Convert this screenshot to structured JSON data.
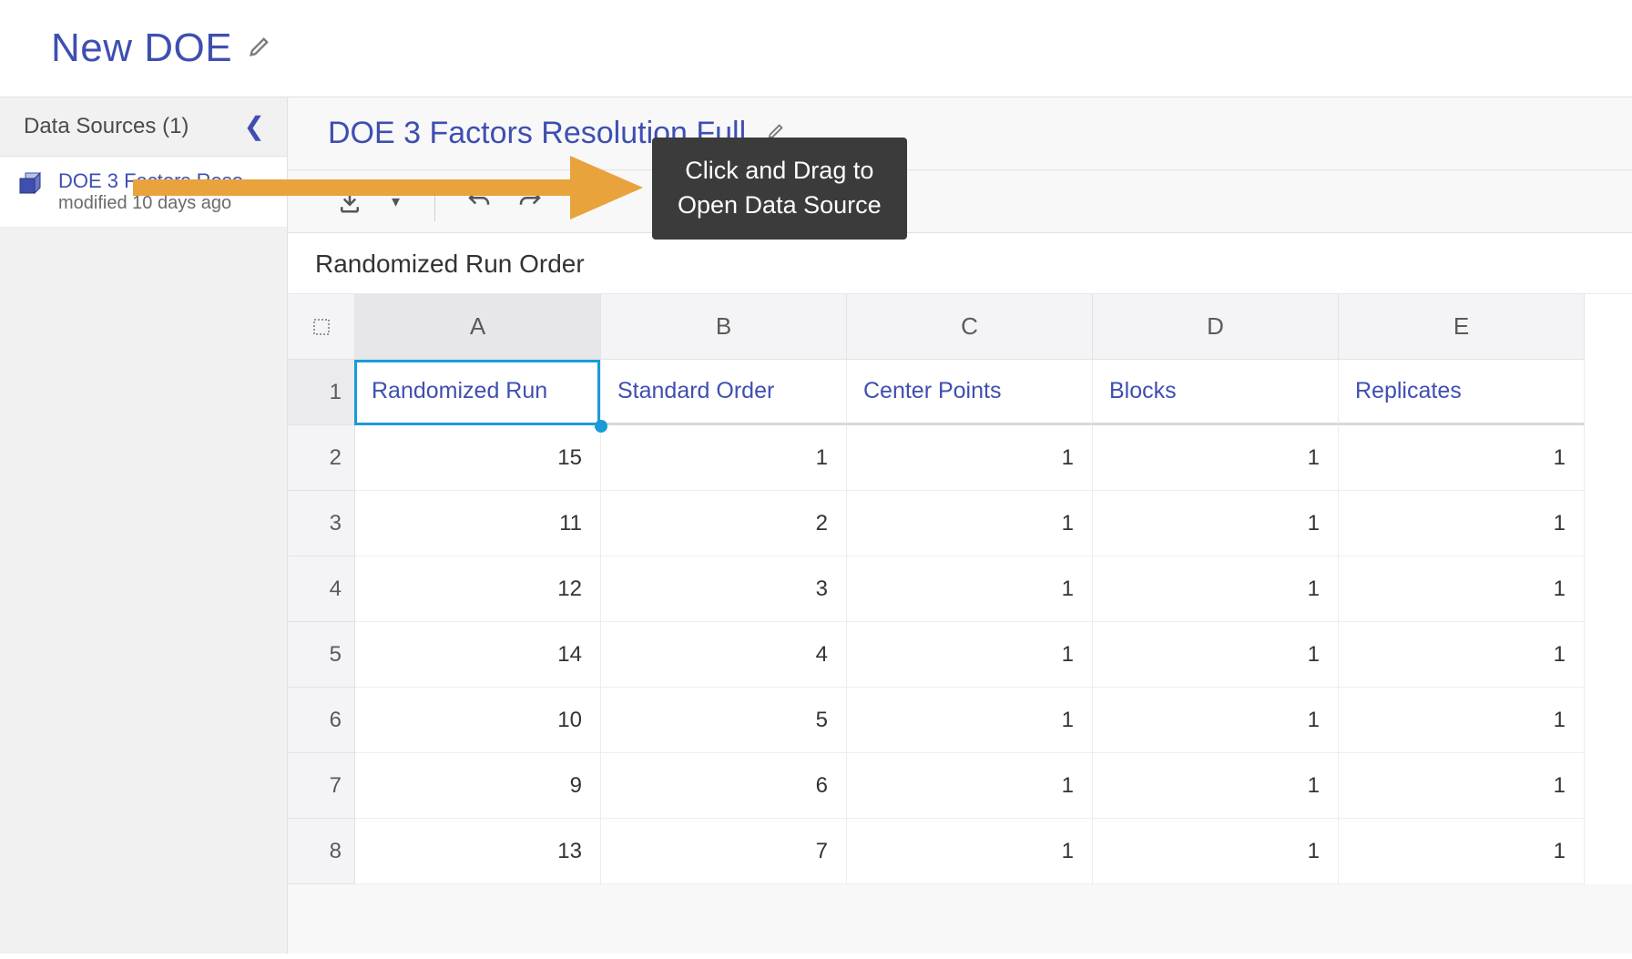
{
  "page": {
    "title": "New DOE"
  },
  "sidebar": {
    "header": "Data Sources (1)",
    "items": [
      {
        "title": "DOE 3 Factors Reso…",
        "subtitle": "modified 10 days ago"
      }
    ]
  },
  "content": {
    "title": "DOE 3 Factors Resolution Full",
    "sheet_title": "Randomized Run Order"
  },
  "tooltip": {
    "line1": "Click and Drag to",
    "line2": "Open Data Source"
  },
  "grid": {
    "column_letters": [
      "A",
      "B",
      "C",
      "D",
      "E"
    ],
    "header_row": [
      "Randomized Run",
      "Standard Order",
      "Center Points",
      "Blocks",
      "Replicates"
    ],
    "rows": [
      [
        15,
        1,
        1,
        1,
        1
      ],
      [
        11,
        2,
        1,
        1,
        1
      ],
      [
        12,
        3,
        1,
        1,
        1
      ],
      [
        14,
        4,
        1,
        1,
        1
      ],
      [
        10,
        5,
        1,
        1,
        1
      ],
      [
        9,
        6,
        1,
        1,
        1
      ],
      [
        13,
        7,
        1,
        1,
        1
      ]
    ]
  }
}
